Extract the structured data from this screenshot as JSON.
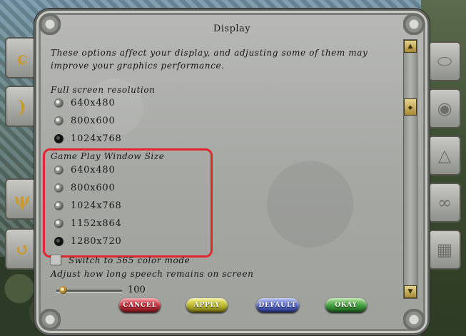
{
  "dialog": {
    "title": "Display",
    "description": "These options affect your display, and adjusting some of them may improve your graphics performance."
  },
  "full_screen": {
    "label": "Full screen resolution",
    "options": [
      {
        "label": "640x480",
        "selected": false
      },
      {
        "label": "800x600",
        "selected": false
      },
      {
        "label": "1024x768",
        "selected": true
      }
    ]
  },
  "game_window": {
    "label": "Game Play Window Size",
    "options": [
      {
        "label": "640x480",
        "selected": false
      },
      {
        "label": "800x600",
        "selected": false
      },
      {
        "label": "1024x768",
        "selected": false
      },
      {
        "label": "1152x864",
        "selected": false
      },
      {
        "label": "1280x720",
        "selected": true
      }
    ]
  },
  "color_mode": {
    "label": "Switch to 565 color mode",
    "checked": false
  },
  "speech": {
    "label": "Adjust how long speech remains on screen",
    "value": "100"
  },
  "buttons": {
    "cancel": "CANCEL",
    "apply": "APPLY",
    "default": "DEFAULT",
    "okay": "OKAY"
  },
  "colors": {
    "highlight": "#e2262f",
    "cancel": "#c0303a",
    "apply": "#b7b42a",
    "default": "#5566c8",
    "okay": "#3f9a3c"
  },
  "side_icons": [
    "mouse-icon",
    "eye-icon",
    "pyramid-icon",
    "figure-eight-icon",
    "grid-icon"
  ],
  "left_icons": [
    "hook-icon",
    "crescent-icon",
    "claw-icon",
    "return-arrow-icon"
  ]
}
